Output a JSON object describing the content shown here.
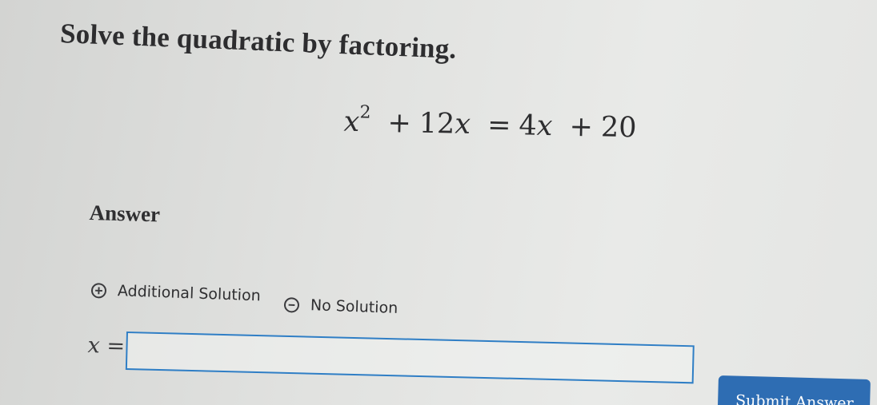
{
  "question": {
    "prompt": "Solve the quadratic by factoring.",
    "equation": {
      "lhs_var": "x",
      "lhs_exponent": "2",
      "plus": "+",
      "lhs_term": "12",
      "lhs_term_var": "x",
      "equals": "=",
      "rhs_term": "4",
      "rhs_term_var": "x",
      "plus2": "+",
      "rhs_const": "20"
    }
  },
  "answer": {
    "label": "Answer",
    "options": {
      "additional_solution": "Additional Solution",
      "no_solution": "No Solution"
    },
    "input_var": "x",
    "input_equals": "=",
    "input_value": ""
  },
  "submit": {
    "label": "Submit Answer"
  },
  "icons": {
    "add": "plus-circle-icon",
    "none": "minus-circle-icon"
  },
  "colors": {
    "accent": "#2e6db3",
    "input_border": "#2f7ec5"
  }
}
